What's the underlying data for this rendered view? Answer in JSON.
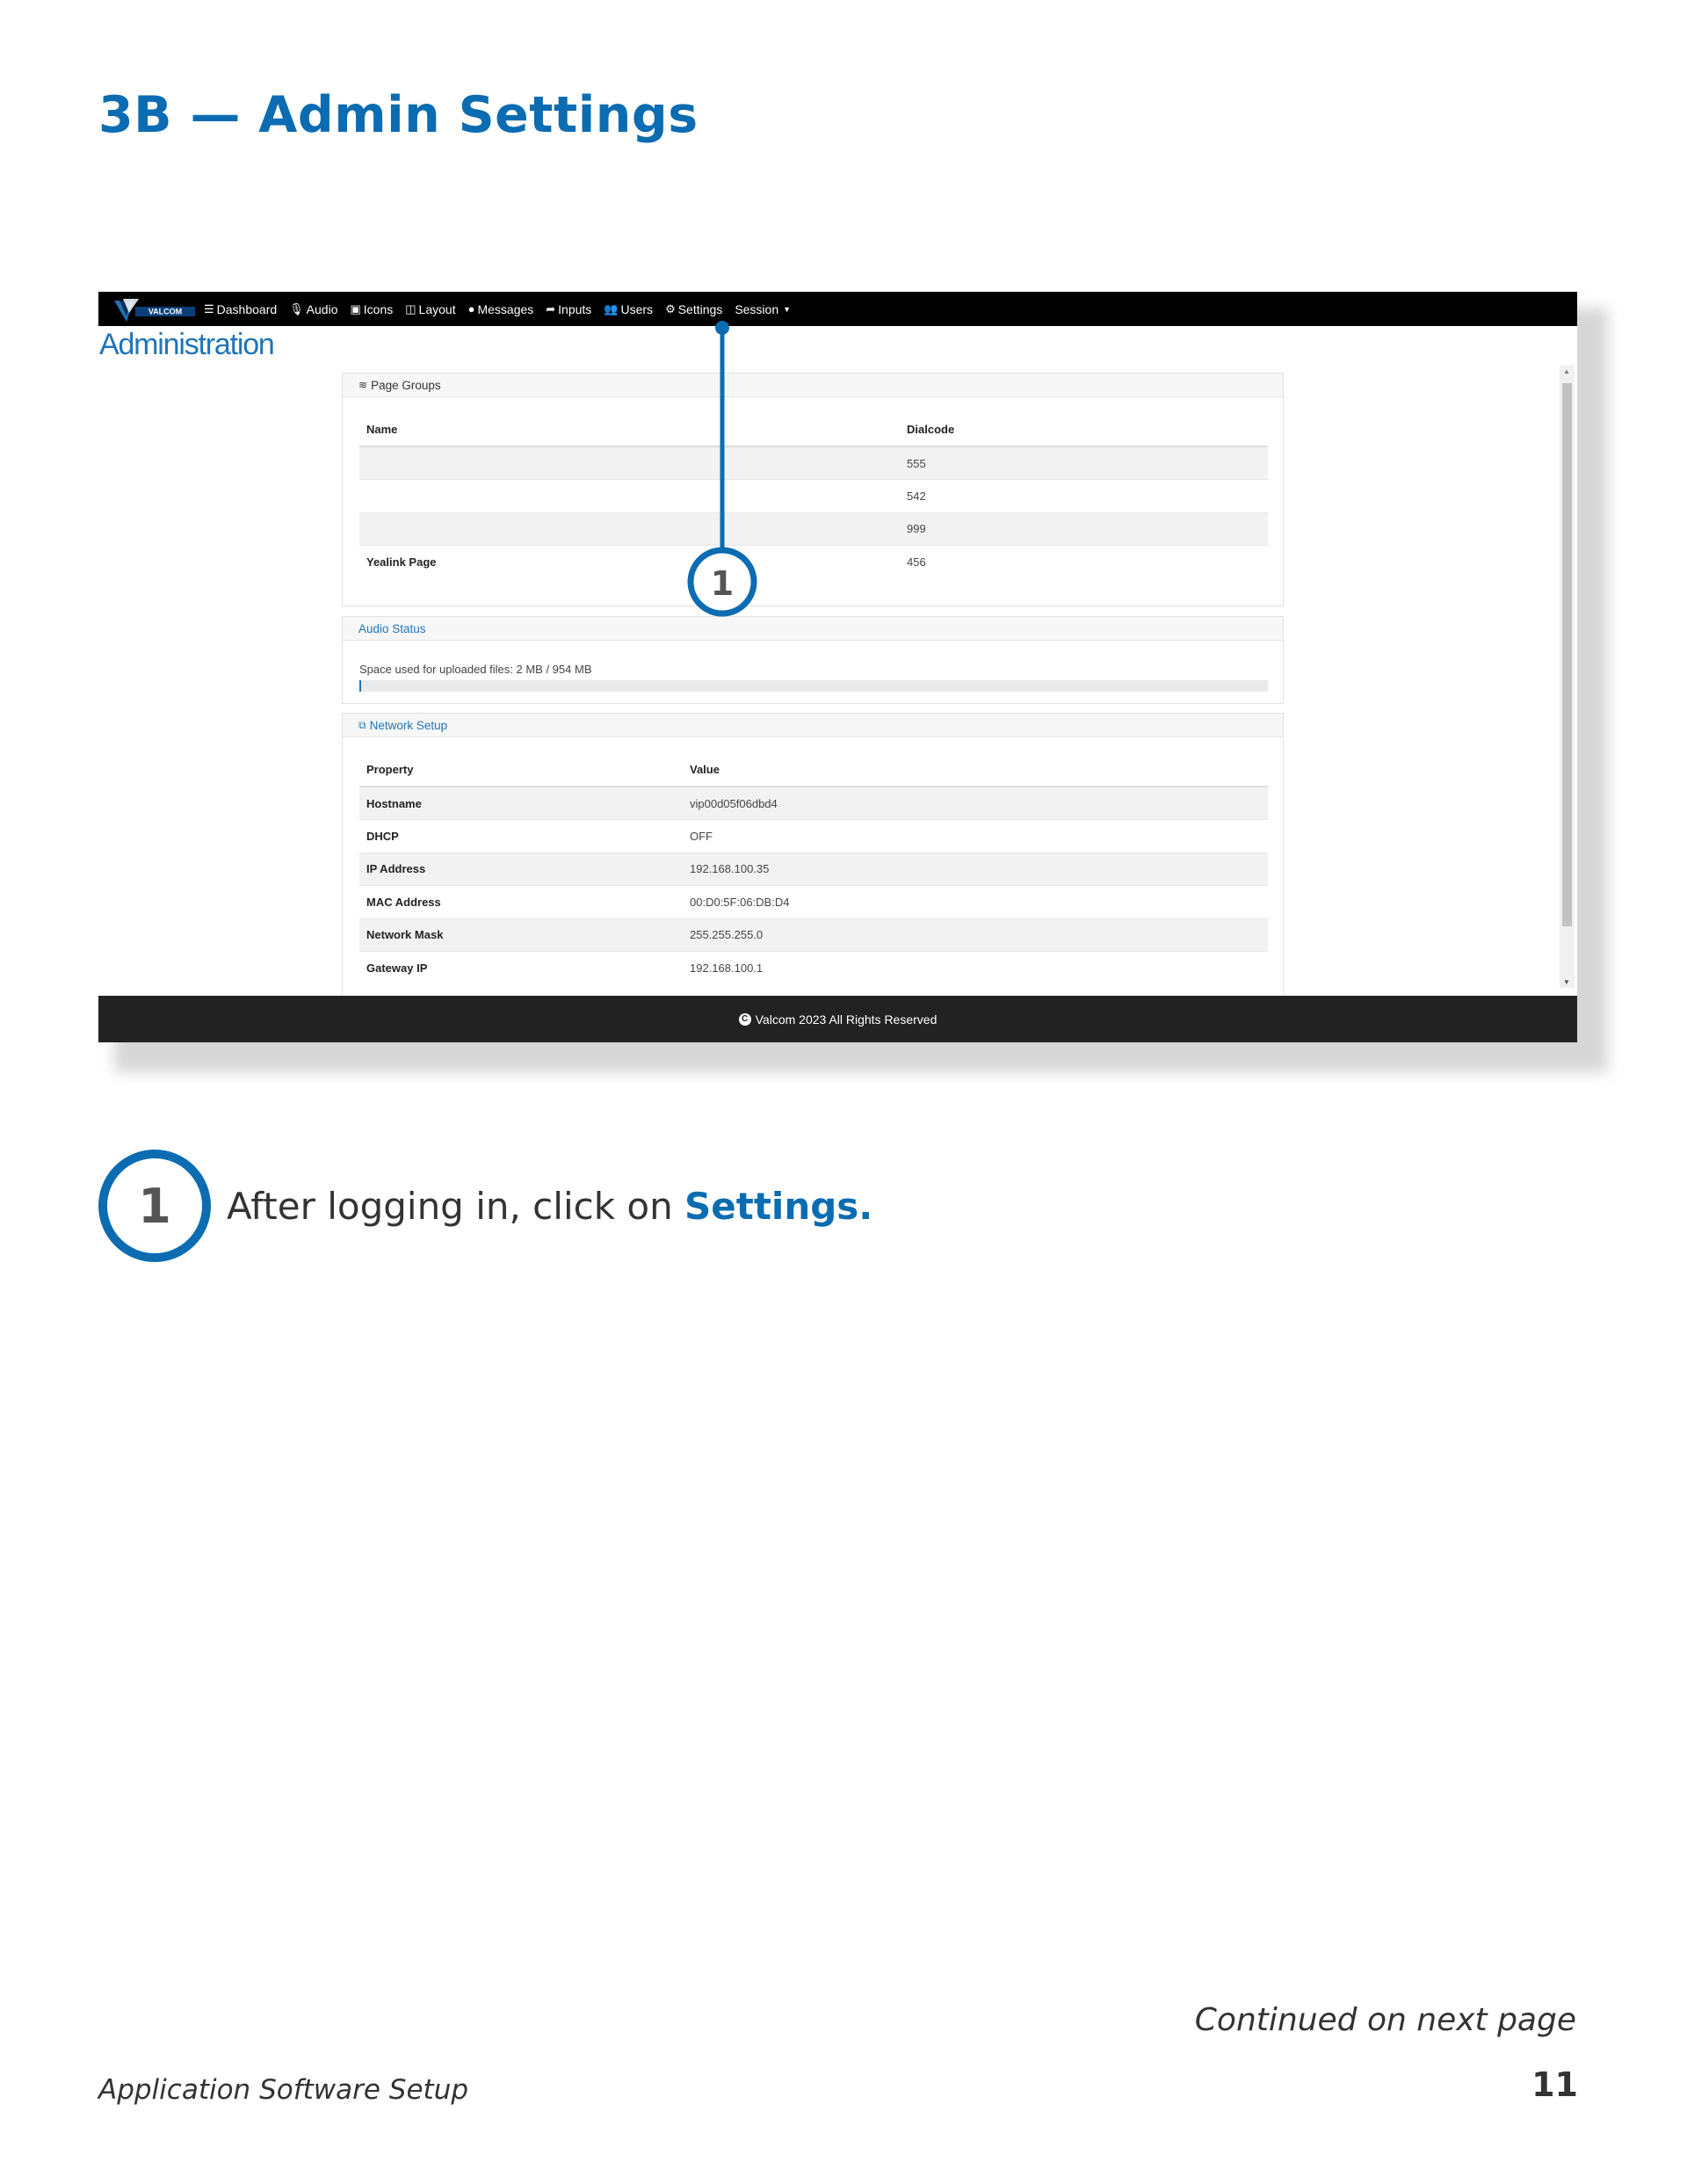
{
  "doc": {
    "title": "3B — Admin Settings",
    "step_number": "1",
    "step_text": "After logging in, click on ",
    "step_highlight": "Settings.",
    "continued": "Continued on next page",
    "footer_left": "Application Software Setup",
    "page_number": "11"
  },
  "colors": {
    "accent": "#0b6cb2",
    "nav_bg": "#000000",
    "footer_bg": "#222222"
  },
  "screenshot": {
    "brand": "VALCOM",
    "nav": [
      {
        "label": "Dashboard",
        "icon": "bars-icon"
      },
      {
        "label": "Audio",
        "icon": "microphone-icon"
      },
      {
        "label": "Icons",
        "icon": "image-icon"
      },
      {
        "label": "Layout",
        "icon": "columns-icon"
      },
      {
        "label": "Messages",
        "icon": "comment-icon"
      },
      {
        "label": "Inputs",
        "icon": "share-icon"
      },
      {
        "label": "Users",
        "icon": "users-icon"
      },
      {
        "label": "Settings",
        "icon": "gears-icon"
      },
      {
        "label": "Session",
        "icon": "caret-down-icon"
      }
    ],
    "page_title": "Administration",
    "page_groups": {
      "heading": "Page Groups",
      "columns": [
        "Name",
        "Dialcode"
      ],
      "rows": [
        {
          "name": "",
          "dialcode": "555"
        },
        {
          "name": "",
          "dialcode": "542"
        },
        {
          "name": "",
          "dialcode": "999"
        },
        {
          "name": "Yealink Page",
          "dialcode": "456"
        }
      ]
    },
    "audio_status": {
      "heading": "Audio Status",
      "space_text": "Space used for uploaded files: 2 MB / 954 MB",
      "used_fraction": 0.002
    },
    "network": {
      "heading": "Network Setup",
      "columns": [
        "Property",
        "Value"
      ],
      "rows": [
        {
          "property": "Hostname",
          "value": "vip00d05f06dbd4"
        },
        {
          "property": "DHCP",
          "value": "OFF"
        },
        {
          "property": "IP Address",
          "value": "192.168.100.35"
        },
        {
          "property": "MAC Address",
          "value": "00:D0:5F:06:DB:D4"
        },
        {
          "property": "Network Mask",
          "value": "255.255.255.0"
        },
        {
          "property": "Gateway IP",
          "value": "192.168.100.1"
        }
      ]
    },
    "footer": "Valcom 2023 All Rights Reserved",
    "callout_number": "1"
  }
}
